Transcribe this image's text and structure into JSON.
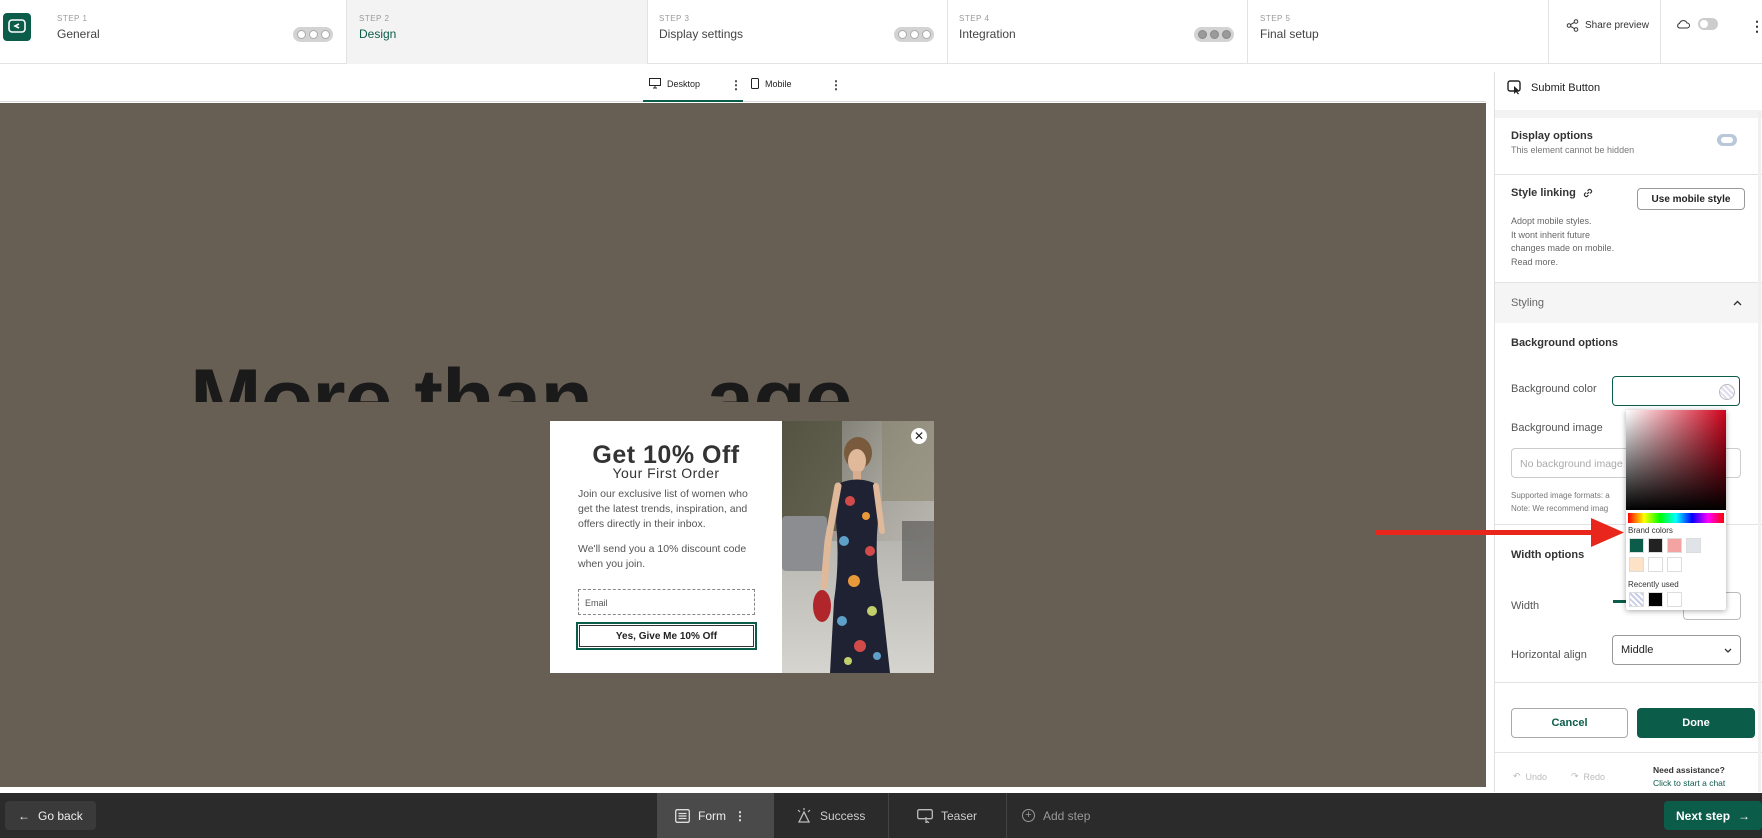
{
  "steps": [
    {
      "num": "STEP 1",
      "name": "General"
    },
    {
      "num": "STEP 2",
      "name": "Design"
    },
    {
      "num": "STEP 3",
      "name": "Display settings"
    },
    {
      "num": "STEP 4",
      "name": "Integration"
    },
    {
      "num": "STEP 5",
      "name": "Final setup"
    }
  ],
  "header": {
    "share_label": "Share preview",
    "active_step": "Design"
  },
  "devices": {
    "desktop": "Desktop",
    "mobile": "Mobile",
    "selected": "Desktop"
  },
  "canvas": {
    "background_text": "More than ... age"
  },
  "popup": {
    "headline": "Get 10% Off",
    "subheadline": "Your First Order",
    "body1": "Join our exclusive list of women who get the latest trends, inspiration, and offers directly in their inbox.",
    "body2": "We'll send you a 10% discount code when you join.",
    "email_placeholder": "Email",
    "cta": "Yes, Give Me 10% Off",
    "close": "✕"
  },
  "panel": {
    "title": "Submit Button",
    "display_options": {
      "title": "Display options",
      "note": "This element cannot be hidden"
    },
    "style_linking": {
      "title": "Style linking",
      "desc_1": "Adopt mobile styles.",
      "desc_2": "It wont inherit future",
      "desc_3": "changes made on mobile.",
      "desc_4": "Read more.",
      "button": "Use mobile style"
    },
    "styling": "Styling",
    "background_options": "Background options",
    "background_color": "Background color",
    "background_image": "Background image",
    "background_image_placeholder": "No background image",
    "supported_line1": "Supported image formats: a",
    "supported_line2": "Note: We recommend imag",
    "width_options": "Width options",
    "width": "Width",
    "horizontal_align": "Horizontal align",
    "horizontal_align_value": "Middle",
    "cancel": "Cancel",
    "done": "Done",
    "undo": "Undo",
    "redo": "Redo",
    "assist_title": "Need assistance?",
    "assist_link": "Click to start a chat"
  },
  "color_picker": {
    "brand_colors_label": "Brand colors",
    "recently_used_label": "Recently used",
    "brand_colors": [
      "#0c5c4a",
      "#222222",
      "#f4a3a3",
      "#e0e3e8",
      "#fde2c8",
      "#ffffff",
      "#ffffff"
    ],
    "recent_colors": [
      "transparent",
      "#000000",
      "#ffffff"
    ]
  },
  "annotation": {
    "arrow_color": "#e8261c"
  },
  "bottom": {
    "go_back": "Go back",
    "tabs": [
      "Form",
      "Success",
      "Teaser"
    ],
    "add_step": "Add step",
    "next_step": "Next step"
  },
  "colors": {
    "brand": "#0c5c4a",
    "canvas_bg": "#685f54"
  }
}
